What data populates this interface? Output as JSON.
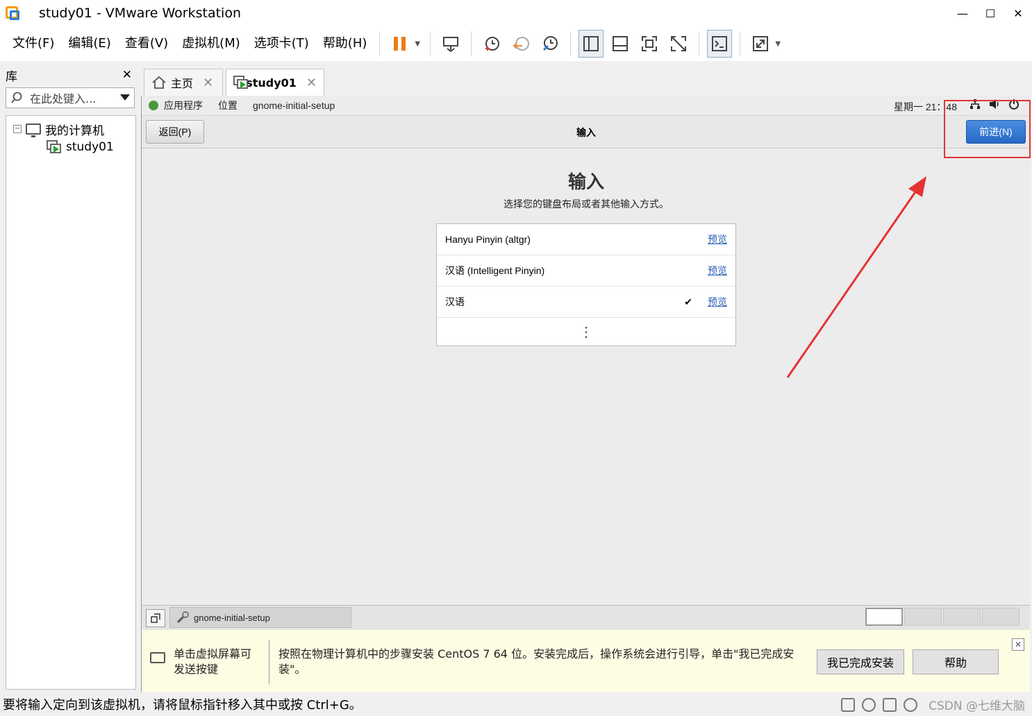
{
  "window": {
    "title": "study01 - VMware Workstation",
    "controls": [
      "—",
      "☐",
      "✕"
    ]
  },
  "menu": [
    "文件(F)",
    "编辑(E)",
    "查看(V)",
    "虚拟机(M)",
    "选项卡(T)",
    "帮助(H)"
  ],
  "library": {
    "title": "库",
    "close": "✕",
    "search_placeholder": "在此处键入...",
    "tree": {
      "root": "我的计算机",
      "vm": "study01",
      "toggle": "−"
    }
  },
  "tabs": [
    {
      "label": "主页",
      "close": "✕"
    },
    {
      "label": "study01",
      "close": "✕"
    }
  ],
  "guest": {
    "topbar": {
      "apps": "应用程序",
      "places": "位置",
      "app_name": "gnome-initial-setup",
      "clock": "星期一 21：48"
    },
    "header": {
      "back": "返回(P)",
      "title": "输入",
      "next": "前进(N)"
    },
    "page": {
      "title": "输入",
      "subtitle": "选择您的键盘布局或者其他输入方式。",
      "sources": [
        {
          "name": "Hanyu Pinyin (altgr)",
          "preview": "预览",
          "selected": false
        },
        {
          "name": "汉语  (Intelligent Pinyin)",
          "preview": "预览",
          "selected": false
        },
        {
          "name": "汉语",
          "preview": "预览",
          "selected": true
        }
      ],
      "more": "⋮",
      "check": "✔"
    },
    "taskbar": {
      "task": "gnome-initial-setup",
      "workspaces": 4
    }
  },
  "hint": {
    "left": "单击虚拟屏幕可发送按键",
    "main": "按照在物理计算机中的步骤安装 CentOS 7 64 位。安装完成后，操作系统会进行引导，单击\"我已完成安装\"。",
    "done_button": "我已完成安装",
    "help_button": "帮助",
    "close": "✕"
  },
  "status": {
    "text": "要将输入定向到该虚拟机，请将鼠标指针移入其中或按 Ctrl+G。",
    "watermark": "CSDN @七维大脑"
  },
  "colors": {
    "accent_blue": "#2568c6",
    "highlight_red": "#e53333",
    "pause_orange": "#f07a1a",
    "hint_bg": "#fdfde3"
  }
}
